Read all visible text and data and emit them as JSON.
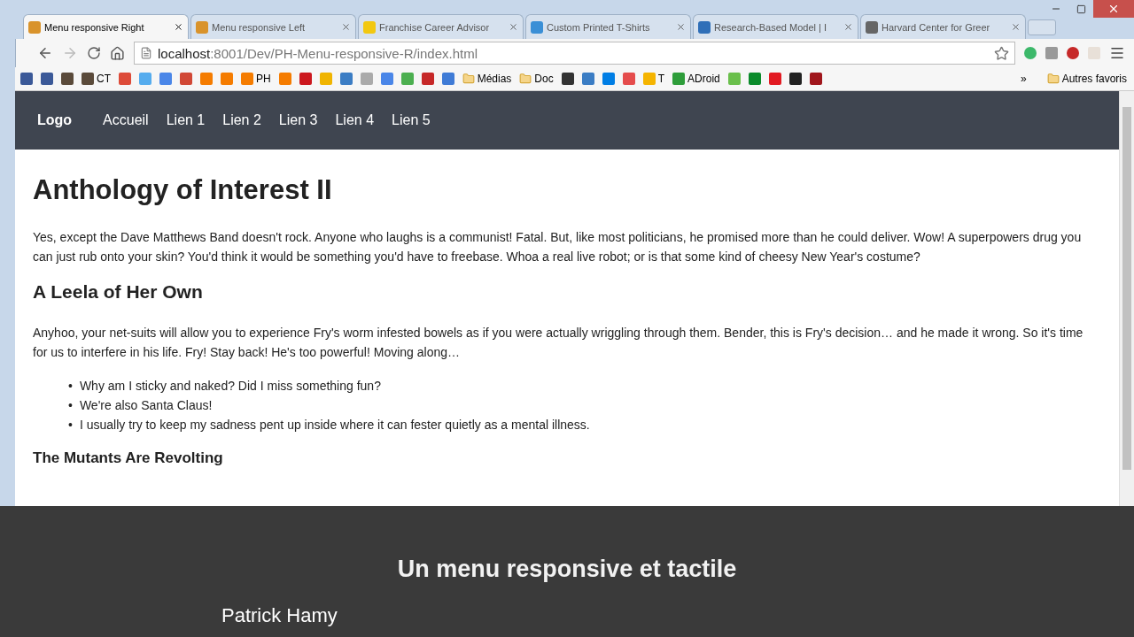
{
  "tabs": [
    {
      "title": "Menu responsive Right",
      "selected": true,
      "color": "#d9932b"
    },
    {
      "title": "Menu responsive Left",
      "selected": false,
      "color": "#d9932b"
    },
    {
      "title": "Franchise Career Advisor",
      "selected": false,
      "color": "#f2c811"
    },
    {
      "title": "Custom Printed T-Shirts",
      "selected": false,
      "color": "#3a8fd6"
    },
    {
      "title": "Research-Based Model | I",
      "selected": false,
      "color": "#2f6fb8"
    },
    {
      "title": "Harvard Center for Greer",
      "selected": false,
      "color": "#666666"
    }
  ],
  "address": {
    "host": "localhost",
    "path": ":8001/Dev/PH-Menu-responsive-R/index.html"
  },
  "bookmarks": [
    {
      "kind": "icon",
      "color": "#3b5998"
    },
    {
      "kind": "icon",
      "color": "#3b5998"
    },
    {
      "kind": "icon",
      "color": "#5a4a3a"
    },
    {
      "kind": "icon",
      "color": "#5a4a3a",
      "label": "CT"
    },
    {
      "kind": "icon",
      "color": "#dd4b39"
    },
    {
      "kind": "icon",
      "color": "#55acee"
    },
    {
      "kind": "icon",
      "color": "#4a86e8"
    },
    {
      "kind": "icon",
      "color": "#d14836"
    },
    {
      "kind": "icon",
      "color": "#f57c00"
    },
    {
      "kind": "icon",
      "color": "#f57c00"
    },
    {
      "kind": "icon",
      "color": "#f57c00",
      "label": "PH"
    },
    {
      "kind": "icon",
      "color": "#f57c00"
    },
    {
      "kind": "icon",
      "color": "#cc181e"
    },
    {
      "kind": "icon",
      "color": "#f0b400"
    },
    {
      "kind": "icon",
      "color": "#3b7dc4"
    },
    {
      "kind": "icon",
      "color": "#aaaaaa"
    },
    {
      "kind": "icon",
      "color": "#4a86e8"
    },
    {
      "kind": "icon",
      "color": "#4caf50"
    },
    {
      "kind": "icon",
      "color": "#c62828"
    },
    {
      "kind": "icon",
      "color": "#3f7bd6"
    },
    {
      "kind": "folder",
      "label": "Médias"
    },
    {
      "kind": "folder",
      "label": "Doc"
    },
    {
      "kind": "icon",
      "color": "#333333"
    },
    {
      "kind": "icon",
      "color": "#3b7dc4"
    },
    {
      "kind": "icon",
      "color": "#007ee5"
    },
    {
      "kind": "icon",
      "color": "#e54c4c"
    },
    {
      "kind": "icon",
      "color": "#f5b400",
      "label": "T"
    },
    {
      "kind": "icon",
      "color": "#2e9d3a",
      "label": "ADroid"
    },
    {
      "kind": "icon",
      "color": "#6abf4b"
    },
    {
      "kind": "icon",
      "color": "#0a8a2a"
    },
    {
      "kind": "icon",
      "color": "#e21a22"
    },
    {
      "kind": "icon",
      "color": "#222222"
    },
    {
      "kind": "icon",
      "color": "#a0161c"
    }
  ],
  "bookmarks_more": "»",
  "other_bookmarks": "Autres favoris",
  "navbar": {
    "logo": "Logo",
    "links": [
      "Accueil",
      "Lien 1",
      "Lien 2",
      "Lien 3",
      "Lien 4",
      "Lien 5"
    ]
  },
  "content": [
    {
      "kind": "h1",
      "text": "Anthology of Interest II"
    },
    {
      "kind": "p",
      "text": "Yes, except the Dave Matthews Band doesn't rock. Anyone who laughs is a communist! Fatal. But, like most politicians, he promised more than he could deliver. Wow! A superpowers drug you can just rub onto your skin? You'd think it would be something you'd have to freebase. Whoa a real live robot; or is that some kind of cheesy New Year's costume?"
    },
    {
      "kind": "h2",
      "text": "A Leela of Her Own"
    },
    {
      "kind": "p",
      "text": "Anyhoo, your net-suits will allow you to experience Fry's worm infested bowels as if you were actually wriggling through them. Bender, this is Fry's decision… and he made it wrong. So it's time for us to interfere in his life. Fry! Stay back! He's too powerful! Moving along…"
    },
    {
      "kind": "ul",
      "marker": "•",
      "items": [
        "Why am I sticky and naked? Did I miss something fun?",
        "We're also Santa Claus!",
        "I usually try to keep my sadness pent up inside where it can fester quietly as a mental illness."
      ]
    },
    {
      "kind": "h3",
      "text": "The Mutants Are Revolting"
    }
  ],
  "overlay": {
    "title": "Un menu responsive et tactile",
    "author": "Patrick Hamy"
  }
}
